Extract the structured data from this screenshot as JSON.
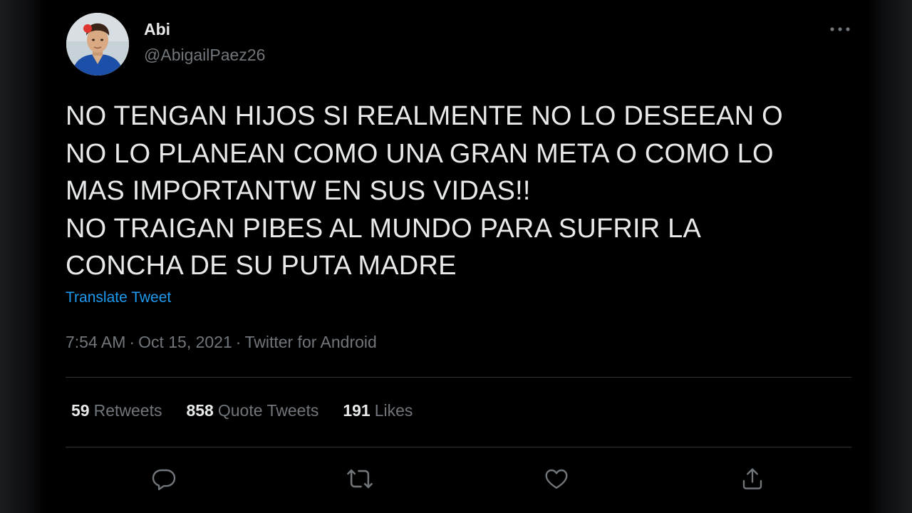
{
  "author": {
    "name": "Abi",
    "handle": "@AbigailPaez26"
  },
  "tweet": {
    "text": "NO TENGAN HIJOS SI REALMENTE NO LO DESEEAN O\nNO LO PLANEAN COMO UNA GRAN META O COMO LO\nMAS IMPORTANTW EN SUS VIDAS!!\nNO TRAIGAN PIBES AL MUNDO PARA SUFRIR LA\nCONCHA DE SU PUTA MADRE",
    "translate_label": "Translate Tweet",
    "time": "7:54 AM",
    "date": "Oct 15, 2021",
    "source": "Twitter for Android",
    "separator": "·"
  },
  "stats": {
    "retweets_count": "59",
    "retweets_label": "Retweets",
    "quotes_count": "858",
    "quotes_label": "Quote Tweets",
    "likes_count": "191",
    "likes_label": "Likes"
  },
  "actions": [
    {
      "icon": "reply-icon"
    },
    {
      "icon": "retweet-icon"
    },
    {
      "icon": "like-icon"
    },
    {
      "icon": "share-icon"
    }
  ],
  "colors": {
    "background": "#000000",
    "text_primary": "#e7e9ea",
    "text_secondary": "#71767b",
    "link": "#1d9bf0",
    "divider": "#2f3336"
  }
}
